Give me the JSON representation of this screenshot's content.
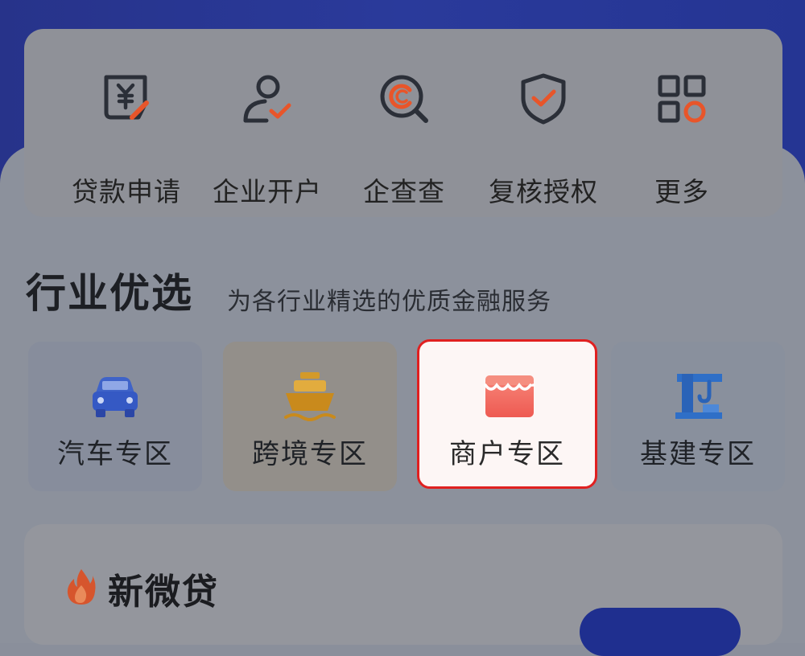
{
  "quick_actions": [
    {
      "label": "贷款申请",
      "icon": "loan-application-icon"
    },
    {
      "label": "企业开户",
      "icon": "enterprise-account-icon"
    },
    {
      "label": "企查查",
      "icon": "company-search-icon"
    },
    {
      "label": "复核授权",
      "icon": "review-authorization-icon"
    },
    {
      "label": "更多",
      "icon": "more-grid-icon"
    }
  ],
  "section": {
    "title": "行业优选",
    "subtitle": "为各行业精选的优质金融服务"
  },
  "zones": [
    {
      "label": "汽车专区",
      "icon": "car-icon"
    },
    {
      "label": "跨境专区",
      "icon": "ship-icon"
    },
    {
      "label": "商户专区",
      "icon": "shop-icon",
      "highlighted": true
    },
    {
      "label": "基建专区",
      "icon": "crane-icon"
    }
  ],
  "product": {
    "title": "新微贷",
    "icon": "fire-icon"
  },
  "colors": {
    "accent_orange": "#e8552a",
    "highlight_border": "#e02020",
    "brand_blue": "#27338a"
  }
}
